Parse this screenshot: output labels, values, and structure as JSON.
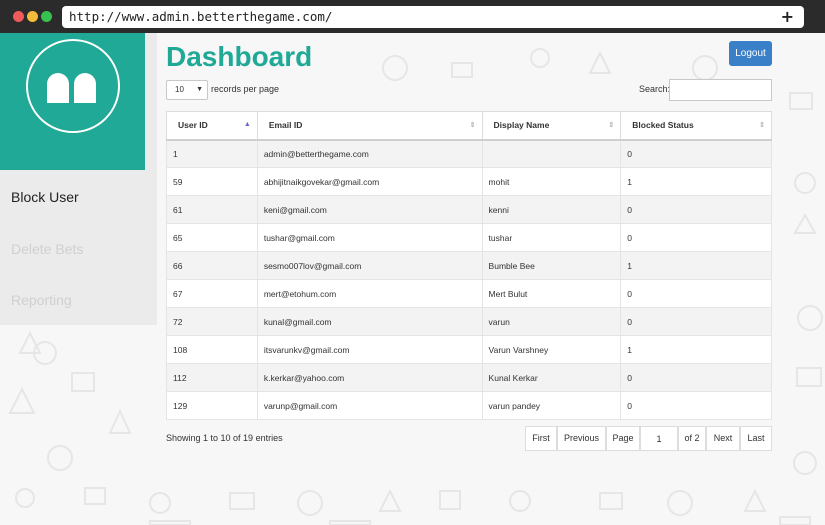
{
  "browser": {
    "url": "http://www.admin.betterthegame.com/"
  },
  "sidebar": {
    "items": [
      {
        "label": "Block User",
        "active": true
      },
      {
        "label": "Delete Bets",
        "active": false
      },
      {
        "label": "Reporting",
        "active": false
      }
    ]
  },
  "header": {
    "title": "Dashboard",
    "logout_label": "Logout"
  },
  "controls": {
    "length_value": "10",
    "length_label": "records per page",
    "search_label": "Search:",
    "search_value": ""
  },
  "table": {
    "columns": [
      "User ID",
      "Email ID",
      "Display Name",
      "Blocked Status"
    ],
    "sorted_column": "User ID",
    "rows": [
      [
        "1",
        "admin@betterthegame.com",
        "",
        "0"
      ],
      [
        "59",
        "abhijitnaikgovekar@gmail.com",
        "mohit",
        "1"
      ],
      [
        "61",
        "keni@gmail.com",
        "kenni",
        "0"
      ],
      [
        "65",
        "tushar@gmail.com",
        "tushar",
        "0"
      ],
      [
        "66",
        "sesmo007lov@gmail.com",
        "Bumble Bee",
        "1"
      ],
      [
        "67",
        "mert@etohum.com",
        "Mert Bulut",
        "0"
      ],
      [
        "72",
        "kunal@gmail.com",
        "varun",
        "0"
      ],
      [
        "108",
        "itsvarunkv@gmail.com",
        "Varun Varshney",
        "1"
      ],
      [
        "112",
        "k.kerkar@yahoo.com",
        "Kunal Kerkar",
        "0"
      ],
      [
        "129",
        "varunp@gmail.com",
        "varun pandey",
        "0"
      ]
    ]
  },
  "footer": {
    "info": "Showing 1 to 10 of 19 entries",
    "first_label": "First",
    "previous_label": "Previous",
    "page_label": "Page",
    "page_value": "1",
    "of_label": "of 2",
    "next_label": "Next",
    "last_label": "Last"
  },
  "colors": {
    "brand": "#1fa996",
    "logout": "#3a80c8",
    "window_bar": "#2b2b2b"
  }
}
